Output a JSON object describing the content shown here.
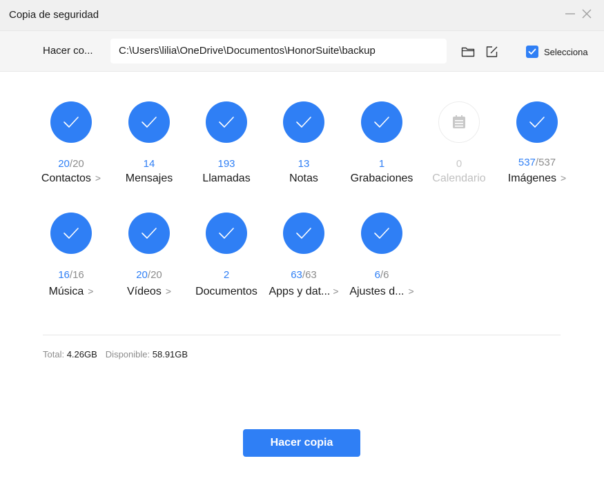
{
  "window": {
    "title": "Copia de seguridad",
    "minimize_icon": "minimize-icon",
    "close_icon": "close-icon"
  },
  "path_bar": {
    "label": "Hacer co...",
    "path_value": "C:\\Users\\lilia\\OneDrive\\Documentos\\HonorSuite\\backup",
    "folder_icon": "folder-icon",
    "edit_icon": "edit-icon",
    "select_all_label": "Selecciona",
    "select_all_checked": true
  },
  "items": [
    {
      "name": "Contactos",
      "selected": "20",
      "total": "/20",
      "chevron": ">",
      "checked": true
    },
    {
      "name": "Mensajes",
      "selected": "14",
      "total": "",
      "chevron": "",
      "checked": true
    },
    {
      "name": "Llamadas",
      "selected": "193",
      "total": "",
      "chevron": "",
      "checked": true
    },
    {
      "name": "Notas",
      "selected": "13",
      "total": "",
      "chevron": "",
      "checked": true
    },
    {
      "name": "Grabaciones",
      "selected": "1",
      "total": "",
      "chevron": "",
      "checked": true
    },
    {
      "name": "Calendario",
      "selected": "0",
      "total": "",
      "chevron": "",
      "checked": false,
      "disabled": true,
      "icon": "calendar-icon"
    },
    {
      "name": "Imágenes",
      "selected": "537",
      "total": "/537",
      "chevron": ">",
      "checked": true
    },
    {
      "name": "Música",
      "selected": "16",
      "total": "/16",
      "chevron": ">",
      "checked": true
    },
    {
      "name": "Vídeos",
      "selected": "20",
      "total": "/20",
      "chevron": ">",
      "checked": true
    },
    {
      "name": "Documentos",
      "selected": "2",
      "total": "",
      "chevron": "",
      "checked": true
    },
    {
      "name": "Apps y dat...",
      "selected": "63",
      "total": "/63",
      "chevron": ">",
      "checked": true
    },
    {
      "name": "Ajustes d...",
      "selected": "6",
      "total": "/6",
      "chevron": ">",
      "checked": true
    }
  ],
  "summary": {
    "total_label": "Total:",
    "total_value": "4.26GB",
    "available_label": "Disponible:",
    "available_value": "58.91GB"
  },
  "actions": {
    "backup_label": "Hacer copia"
  },
  "colors": {
    "accent": "#2f7ff5",
    "muted": "#8c8c8c",
    "disabled": "#c8c8c8"
  }
}
